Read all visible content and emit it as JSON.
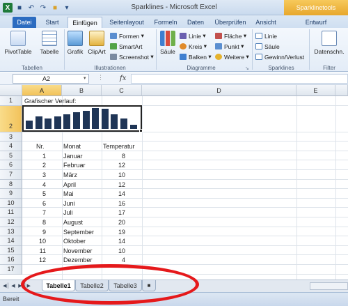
{
  "window": {
    "title": "Sparklines - Microsoft Excel",
    "context_tab": "Sparklinetools"
  },
  "tabs": [
    "Datei",
    "Start",
    "Einfügen",
    "Seitenlayout",
    "Formeln",
    "Daten",
    "Überprüfen",
    "Ansicht",
    "Entwurf"
  ],
  "ribbon": {
    "groups": {
      "tabellen": "Tabellen",
      "illustrationen": "Illustrationen",
      "diagramme": "Diagramme",
      "sparklines": "Sparklines",
      "filter": "Filter"
    },
    "pivottable": "PivotTable",
    "tabelle": "Tabelle",
    "grafik": "Grafik",
    "clipart": "ClipArt",
    "formen": "Formen",
    "smartart": "SmartArt",
    "screenshot": "Screenshot",
    "saule": "Säule",
    "linie": "Linie",
    "kreis": "Kreis",
    "balken": "Balken",
    "flache": "Fläche",
    "punkt": "Punkt",
    "weitere": "Weitere",
    "spark_linie": "Linie",
    "spark_saule": "Säule",
    "gewinn": "Gewinn/Verlust",
    "datenschn": "Datenschn."
  },
  "formula_bar": {
    "name_box": "A2",
    "fx": "fx",
    "formula": ""
  },
  "columns": [
    "A",
    "B",
    "C",
    "D",
    "E"
  ],
  "rows": [
    "1",
    "2",
    "3",
    "4",
    "5",
    "6",
    "7",
    "8",
    "9",
    "10",
    "11",
    "12",
    "13",
    "14",
    "15",
    "16",
    "17"
  ],
  "sheet": {
    "a1": "Grafischer Verlauf:",
    "headers": {
      "nr": "Nr.",
      "monat": "Monat",
      "temperatur": "Temperatur"
    },
    "data": [
      {
        "nr": "1",
        "monat": "Januar",
        "temp": "8"
      },
      {
        "nr": "2",
        "monat": "Februar",
        "temp": "12"
      },
      {
        "nr": "3",
        "monat": "März",
        "temp": "10"
      },
      {
        "nr": "4",
        "monat": "April",
        "temp": "12"
      },
      {
        "nr": "5",
        "monat": "Mai",
        "temp": "14"
      },
      {
        "nr": "6",
        "monat": "Juni",
        "temp": "16"
      },
      {
        "nr": "7",
        "monat": "Juli",
        "temp": "17"
      },
      {
        "nr": "8",
        "monat": "August",
        "temp": "20"
      },
      {
        "nr": "9",
        "monat": "September",
        "temp": "19"
      },
      {
        "nr": "10",
        "monat": "Oktober",
        "temp": "14"
      },
      {
        "nr": "11",
        "monat": "November",
        "temp": "10"
      },
      {
        "nr": "12",
        "monat": "Dezember",
        "temp": "4"
      }
    ]
  },
  "sheet_tabs": [
    "Tabelle1",
    "Tabelle2",
    "Tabelle3"
  ],
  "status": "Bereit",
  "colors": {
    "sparkline": "#1f3556",
    "annotation": "#e5191b",
    "selection": "#f2c25a"
  }
}
